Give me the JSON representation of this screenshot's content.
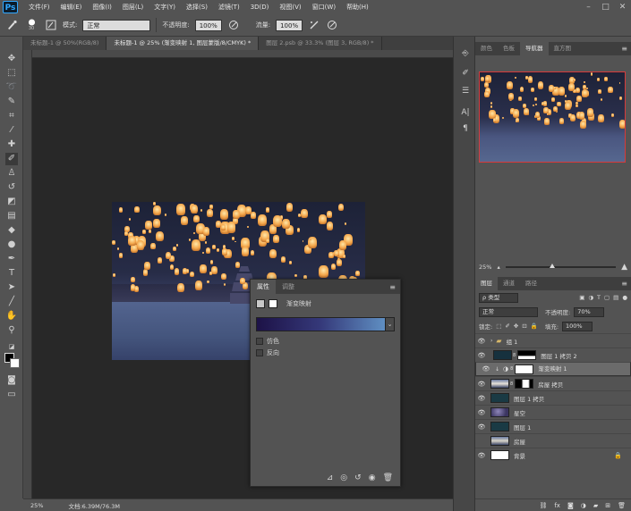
{
  "app": {
    "logo": "Ps",
    "menu": [
      "文件(F)",
      "编辑(E)",
      "图像(I)",
      "图层(L)",
      "文字(Y)",
      "选择(S)",
      "滤镜(T)",
      "3D(D)",
      "视图(V)",
      "窗口(W)",
      "帮助(H)"
    ],
    "window_controls": [
      "–",
      "□",
      "✕"
    ]
  },
  "options": {
    "brush_size": "30",
    "mode_label": "模式:",
    "mode_value": "正常",
    "opacity_label": "不透明度:",
    "opacity_value": "100%",
    "flow_label": "流量:",
    "flow_value": "100%"
  },
  "tabs": [
    {
      "label": "未标题-1 @ 50%(RGB/8)",
      "active": false
    },
    {
      "label": "未标题-1 @ 25% (渐变映射 1, 图层蒙版/8/CMYK) *",
      "active": true
    },
    {
      "label": "图层 2.psb @ 33.3% (图层 3, RGB/8) *",
      "active": false
    }
  ],
  "properties": {
    "tabs": [
      "属性",
      "调整"
    ],
    "title": "渐变映射",
    "dither": "仿色",
    "reverse": "反向"
  },
  "status": {
    "zoom": "25%",
    "doc": "文档:6.39M/76.3M"
  },
  "right_tabs": [
    "颜色",
    "色板",
    "导航器",
    "直方图"
  ],
  "navigator": {
    "zoom": "25%"
  },
  "layers": {
    "tabs": [
      "图层",
      "通道",
      "路径"
    ],
    "filter": "ρ 类型",
    "blend": "正常",
    "opacity_label": "不透明度:",
    "opacity_value": "70%",
    "lock_label": "锁定:",
    "fill_label": "填充:",
    "fill_value": "100%",
    "items": [
      {
        "name": "组 1",
        "visible": true,
        "kind": "group"
      },
      {
        "name": "图层 1 拷贝 2",
        "visible": true,
        "kind": "masked"
      },
      {
        "name": "渐变映射 1",
        "visible": true,
        "kind": "adjust",
        "selected": true
      },
      {
        "name": "房屋 拷贝",
        "visible": true,
        "kind": "masked-photo"
      },
      {
        "name": "图层 1 拷贝",
        "visible": true,
        "kind": "dark"
      },
      {
        "name": "星空",
        "visible": true,
        "kind": "sky"
      },
      {
        "name": "图层 1",
        "visible": true,
        "kind": "dark"
      },
      {
        "name": "房屋",
        "visible": false,
        "kind": "photo"
      },
      {
        "name": "背景",
        "visible": true,
        "kind": "white"
      }
    ]
  },
  "colors": {
    "accent_red": "#d63a3a",
    "selected_layer": "#6b6b6b"
  }
}
